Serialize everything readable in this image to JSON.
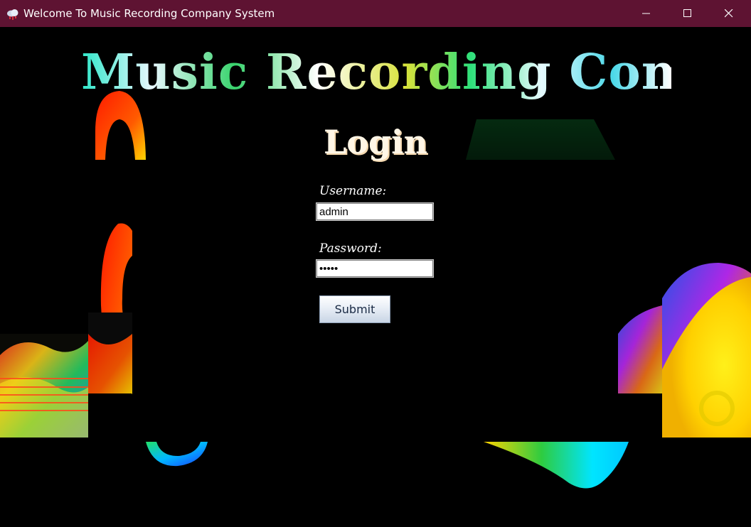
{
  "window": {
    "title": "Welcome To Music Recording Company System",
    "controls": [
      "minimize",
      "maximize",
      "close"
    ],
    "titlebar_color": "#5e1332"
  },
  "app_heading": "Music Recording Company",
  "login_heading": "Login",
  "form": {
    "username_label": "Username:",
    "username_value": "admin",
    "password_label": "Password:",
    "password_value": "•••••",
    "submit_label": "Submit"
  },
  "colors": {
    "background": "#000000",
    "field_background": "#ffffff",
    "label_text": "#ffffff"
  }
}
